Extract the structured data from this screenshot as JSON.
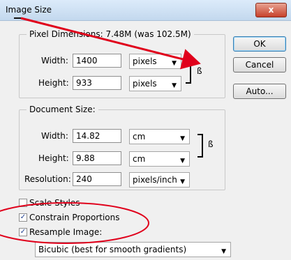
{
  "window": {
    "title": "Image Size",
    "close_label": "x"
  },
  "pixel_dimensions": {
    "legend": "Pixel Dimensions:  7.48M (was 102.5M)",
    "width": {
      "label": "Width:",
      "value": "1400",
      "unit": "pixels"
    },
    "height": {
      "label": "Height:",
      "value": "933",
      "unit": "pixels"
    }
  },
  "document_size": {
    "legend": "Document Size:",
    "width": {
      "label": "Width:",
      "value": "14.82",
      "unit": "cm"
    },
    "height": {
      "label": "Height:",
      "value": "9.88",
      "unit": "cm"
    },
    "resolution": {
      "label": "Resolution:",
      "value": "240",
      "unit": "pixels/inch"
    }
  },
  "buttons": {
    "ok": "OK",
    "cancel": "Cancel",
    "auto": "Auto..."
  },
  "options": {
    "scale_styles": {
      "label": "Scale Styles",
      "checked": false
    },
    "constrain_proportions": {
      "label": "Constrain Proportions",
      "checked": true
    },
    "resample_image": {
      "label": "Resample Image:",
      "checked": true
    },
    "resample_method": "Bicubic (best for smooth gradients)"
  },
  "icons": {
    "link": "chain-link-icon",
    "dropdown": "chevron-down-icon"
  },
  "annotation_color": "#e0001b"
}
